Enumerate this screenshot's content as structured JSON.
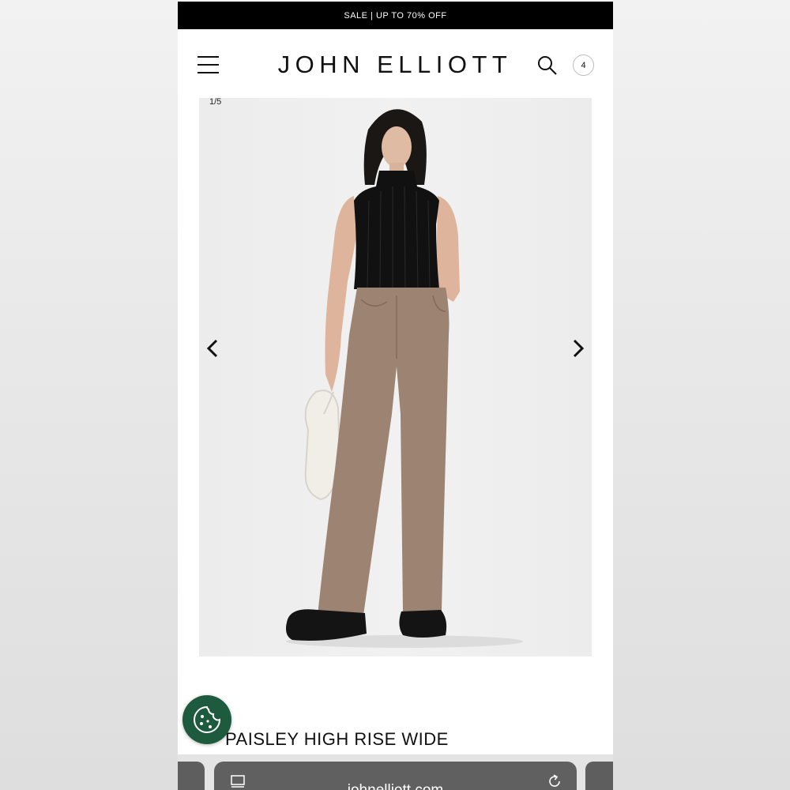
{
  "promo": {
    "text": "SALE | UP TO 70% OFF"
  },
  "header": {
    "logo": "JOHN ELLIOTT",
    "cart_count": "4",
    "icons": [
      "menu-icon",
      "search-icon"
    ]
  },
  "gallery": {
    "counter": "1/5",
    "icons": [
      "chevron-left-icon",
      "chevron-right-icon"
    ]
  },
  "product": {
    "title": "PAISLEY HIGH RISE WIDE"
  },
  "cookie": {
    "icon": "cookie-icon",
    "color": "#1e5a3e"
  },
  "browser": {
    "url": "johnelliott.com",
    "icons": [
      "page-icon",
      "reload-icon"
    ]
  }
}
